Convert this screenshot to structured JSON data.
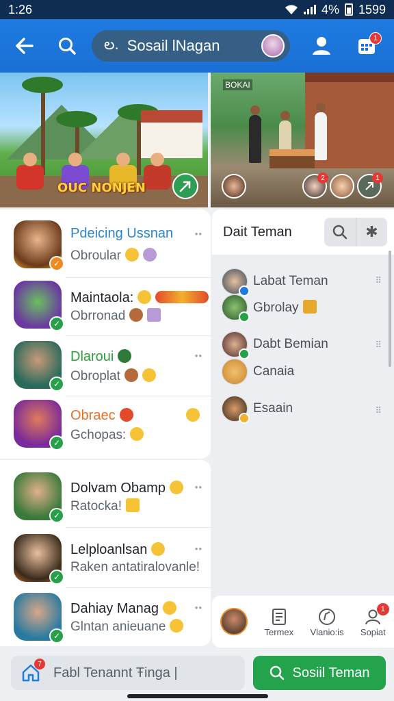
{
  "status": {
    "time": "1:26",
    "battery": "4%",
    "signal_value": "1599"
  },
  "app_bar": {
    "title": "Sosail lNagan",
    "prefix": "ల.",
    "grid_badge": "1"
  },
  "banners": {
    "left_title": "OUC NONJEN",
    "right_tag": "ΒΟΚΑΙ",
    "right_badge_1": "2",
    "right_badge_2": "1"
  },
  "chats": [
    {
      "name": "Pdeicing Ussnan",
      "sub": "Obroular",
      "name_color": "#2a86c8"
    },
    {
      "name": "Maintaola:",
      "sub": "Obrronad",
      "name_color": "#1f2329"
    },
    {
      "name": "Dlaroui",
      "sub": "Obroplat",
      "name_color": "#2e9e3a"
    },
    {
      "name": "Obraec",
      "sub": "Gchopas:",
      "name_color": "#e8702a"
    },
    {
      "name": "Dolvam Obamp",
      "sub": "Ratocka!",
      "name_color": "#1f2329"
    },
    {
      "name": "Lelploanlsan",
      "sub": "Raken antatiralovanle!",
      "name_color": "#1f2329"
    },
    {
      "name": "Dahiay Manag",
      "sub": "Glntan anieuane",
      "name_color": "#1f2329"
    }
  ],
  "right_panel": {
    "title": "Dait Teman",
    "friends": [
      {
        "name": "Labat Teman"
      },
      {
        "name": "Gbrolay"
      },
      {
        "name": "Dabt Bemian"
      },
      {
        "name": "Canaia"
      },
      {
        "name": "Esaain"
      }
    ],
    "tabs": [
      {
        "label": "Termex",
        "icon": "document-icon"
      },
      {
        "label": "Vlanio:is",
        "icon": "compass-icon"
      },
      {
        "label": "Sopiat",
        "icon": "person-icon",
        "badge": "1"
      }
    ]
  },
  "bottom": {
    "input_text": "Fabl Tenannt Ŧinga |",
    "home_badge": "7",
    "button_label": "Sosiil Teman"
  }
}
